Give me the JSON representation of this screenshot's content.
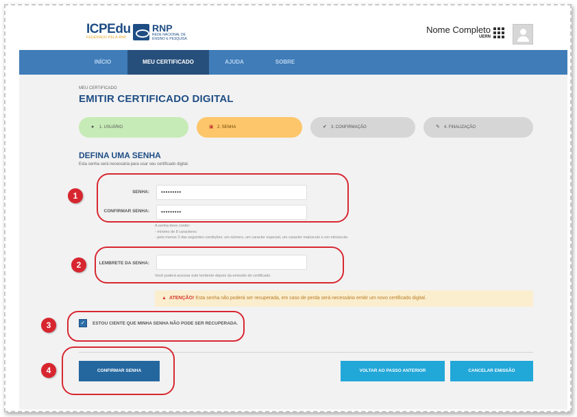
{
  "header": {
    "logo_icp_main": "ICPEdu",
    "logo_icp_sub": "FEDERADO PELA RNP",
    "logo_rnp_title": "RNP",
    "logo_rnp_sub1": "REDE NACIONAL DE",
    "logo_rnp_sub2": "ENSINO E PESQUISA",
    "user_name": "Nome Completo",
    "user_org": "UERN",
    "apps_icon": "grid-apps-icon",
    "avatar_icon": "user-avatar-icon"
  },
  "nav": {
    "items": [
      {
        "label": "INÍCIO",
        "active": false
      },
      {
        "label": "MEU CERTIFICADO",
        "active": true
      },
      {
        "label": "AJUDA",
        "active": false
      },
      {
        "label": "SOBRE",
        "active": false
      }
    ]
  },
  "breadcrumb": "MEU CERTIFICADO",
  "page_title": "EMITIR CERTIFICADO DIGITAL",
  "steps": [
    {
      "label": "1. USUÁRIO",
      "icon": "user-icon",
      "state": "done",
      "color": "#c6ebb7"
    },
    {
      "label": "2. SENHA",
      "icon": "lock-icon",
      "state": "current",
      "color": "#fdc66b"
    },
    {
      "label": "3. CONFIRMAÇÃO",
      "icon": "check-circle-icon",
      "state": "pending",
      "color": "#d6d6d6"
    },
    {
      "label": "4. FINALIZAÇÃO",
      "icon": "signature-icon",
      "state": "pending",
      "color": "#d6d6d6"
    }
  ],
  "section": {
    "title": "DEFINA UMA SENHA",
    "description": "Esta senha será necessária para usar seu certificado digital."
  },
  "form": {
    "password_label": "SENHA:",
    "password_value": "•••••••••",
    "confirm_label": "CONFIRMAR SENHA:",
    "confirm_value": "•••••••••",
    "rules": [
      "A senha deve conter:",
      "- mínimo de 8 caracteres",
      "- pelo menos 3 das seguintes condições: um número, um caracter especial, um caracter maiúsculo e um minúsculo."
    ],
    "hint_label": "LEMBRETE DA SENHA:",
    "hint_value": "",
    "hint_note": "Você poderá acessar este lembrete depois da emissão do certificado."
  },
  "alert": {
    "icon": "warning-icon",
    "strong": "ATENÇÃO!",
    "text": "Esta senha não poderá ser recuperada, em caso de perda será necessário emitir um novo certificado digital."
  },
  "checkbox": {
    "checked": true,
    "label": "ESTOU CIENTE QUE MINHA SENHA NÃO PODE SER RECUPERADA."
  },
  "buttons": {
    "confirm": "CONFIRMAR SENHA",
    "back": "VOLTAR AO PASSO ANTERIOR",
    "cancel": "CANCELAR EMISSÃO"
  },
  "annotations": [
    "1",
    "2",
    "3",
    "4"
  ],
  "colors": {
    "nav": "#3f7cb8",
    "nav_active": "#274f7b",
    "primary": "#24679f",
    "secondary": "#21a7d8",
    "annotation": "#d7262f"
  }
}
